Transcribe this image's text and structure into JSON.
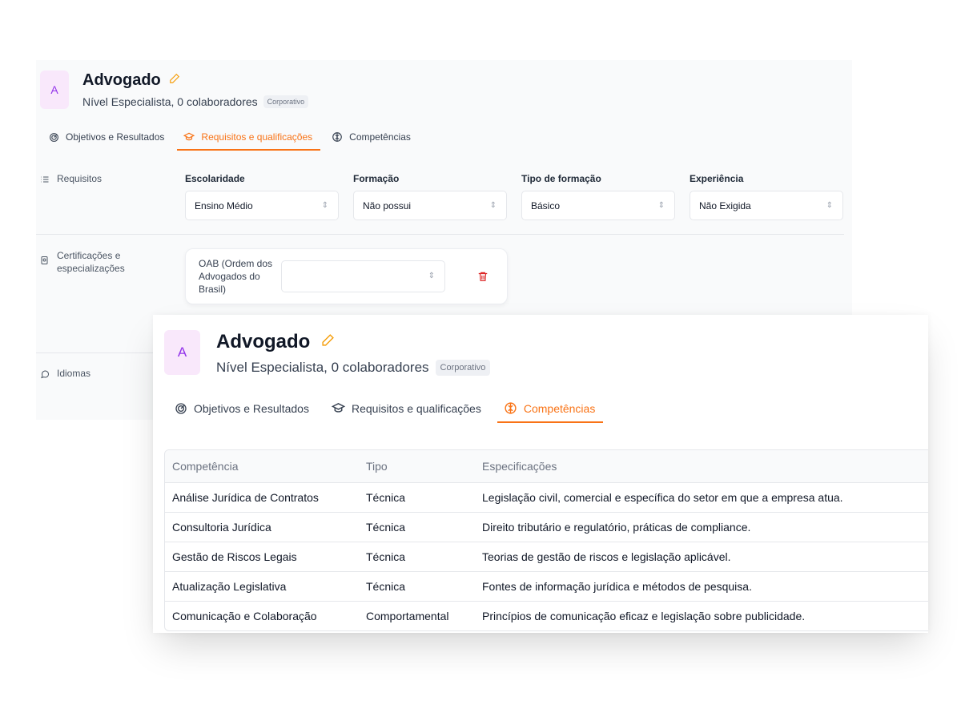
{
  "back": {
    "avatar": "A",
    "title": "Advogado",
    "subtitle": "Nível Especialista, 0 colaboradores",
    "tag": "Corporativo",
    "tabs": [
      {
        "label": "Objetivos e Resultados"
      },
      {
        "label": "Requisitos e qualificações"
      },
      {
        "label": "Competências"
      }
    ],
    "active_tab": 1,
    "sections": {
      "requisitos": "Requisitos",
      "certificacoes": "Certificações e especializações",
      "idiomas": "Idiomas"
    },
    "fields": [
      {
        "label": "Escolaridade",
        "value": "Ensino Médio"
      },
      {
        "label": "Formação",
        "value": "Não possui"
      },
      {
        "label": "Tipo de formação",
        "value": "Básico"
      },
      {
        "label": "Experiência",
        "value": "Não Exigida"
      }
    ],
    "certificate": {
      "name": "OAB (Ordem dos Advogados do Brasil)",
      "value": ""
    }
  },
  "front": {
    "avatar": "A",
    "title": "Advogado",
    "subtitle": "Nível Especialista, 0 colaboradores",
    "tag": "Corporativo",
    "tabs": [
      {
        "label": "Objetivos e Resultados"
      },
      {
        "label": "Requisitos e qualificações"
      },
      {
        "label": "Competências"
      }
    ],
    "active_tab": 2,
    "table": {
      "headers": [
        "Competência",
        "Tipo",
        "Especificações"
      ],
      "rows": [
        [
          "Análise Jurídica de Contratos",
          "Técnica",
          "Legislação civil, comercial e específica do setor em que a empresa atua."
        ],
        [
          "Consultoria Jurídica",
          "Técnica",
          "Direito tributário e regulatório, práticas de compliance."
        ],
        [
          "Gestão de Riscos Legais",
          "Técnica",
          "Teorias de gestão de riscos e legislação aplicável."
        ],
        [
          "Atualização Legislativa",
          "Técnica",
          "Fontes de informação jurídica e métodos de pesquisa."
        ],
        [
          "Comunicação e Colaboração",
          "Comportamental",
          "Princípios de comunicação eficaz e legislação sobre publicidade."
        ]
      ]
    }
  },
  "colors": {
    "accent": "#f97316",
    "avatar_bg": "#f9e8fb",
    "avatar_text": "#9333ea",
    "danger": "#dc2626"
  },
  "icons": {
    "tab_icons": [
      "target-icon",
      "graduation-cap-icon",
      "brain-icon"
    ],
    "edit": "pencil-icon",
    "list": "list-icon",
    "certificate": "certificate-icon",
    "chat": "chat-bubble-icon",
    "delete": "trash-icon"
  }
}
